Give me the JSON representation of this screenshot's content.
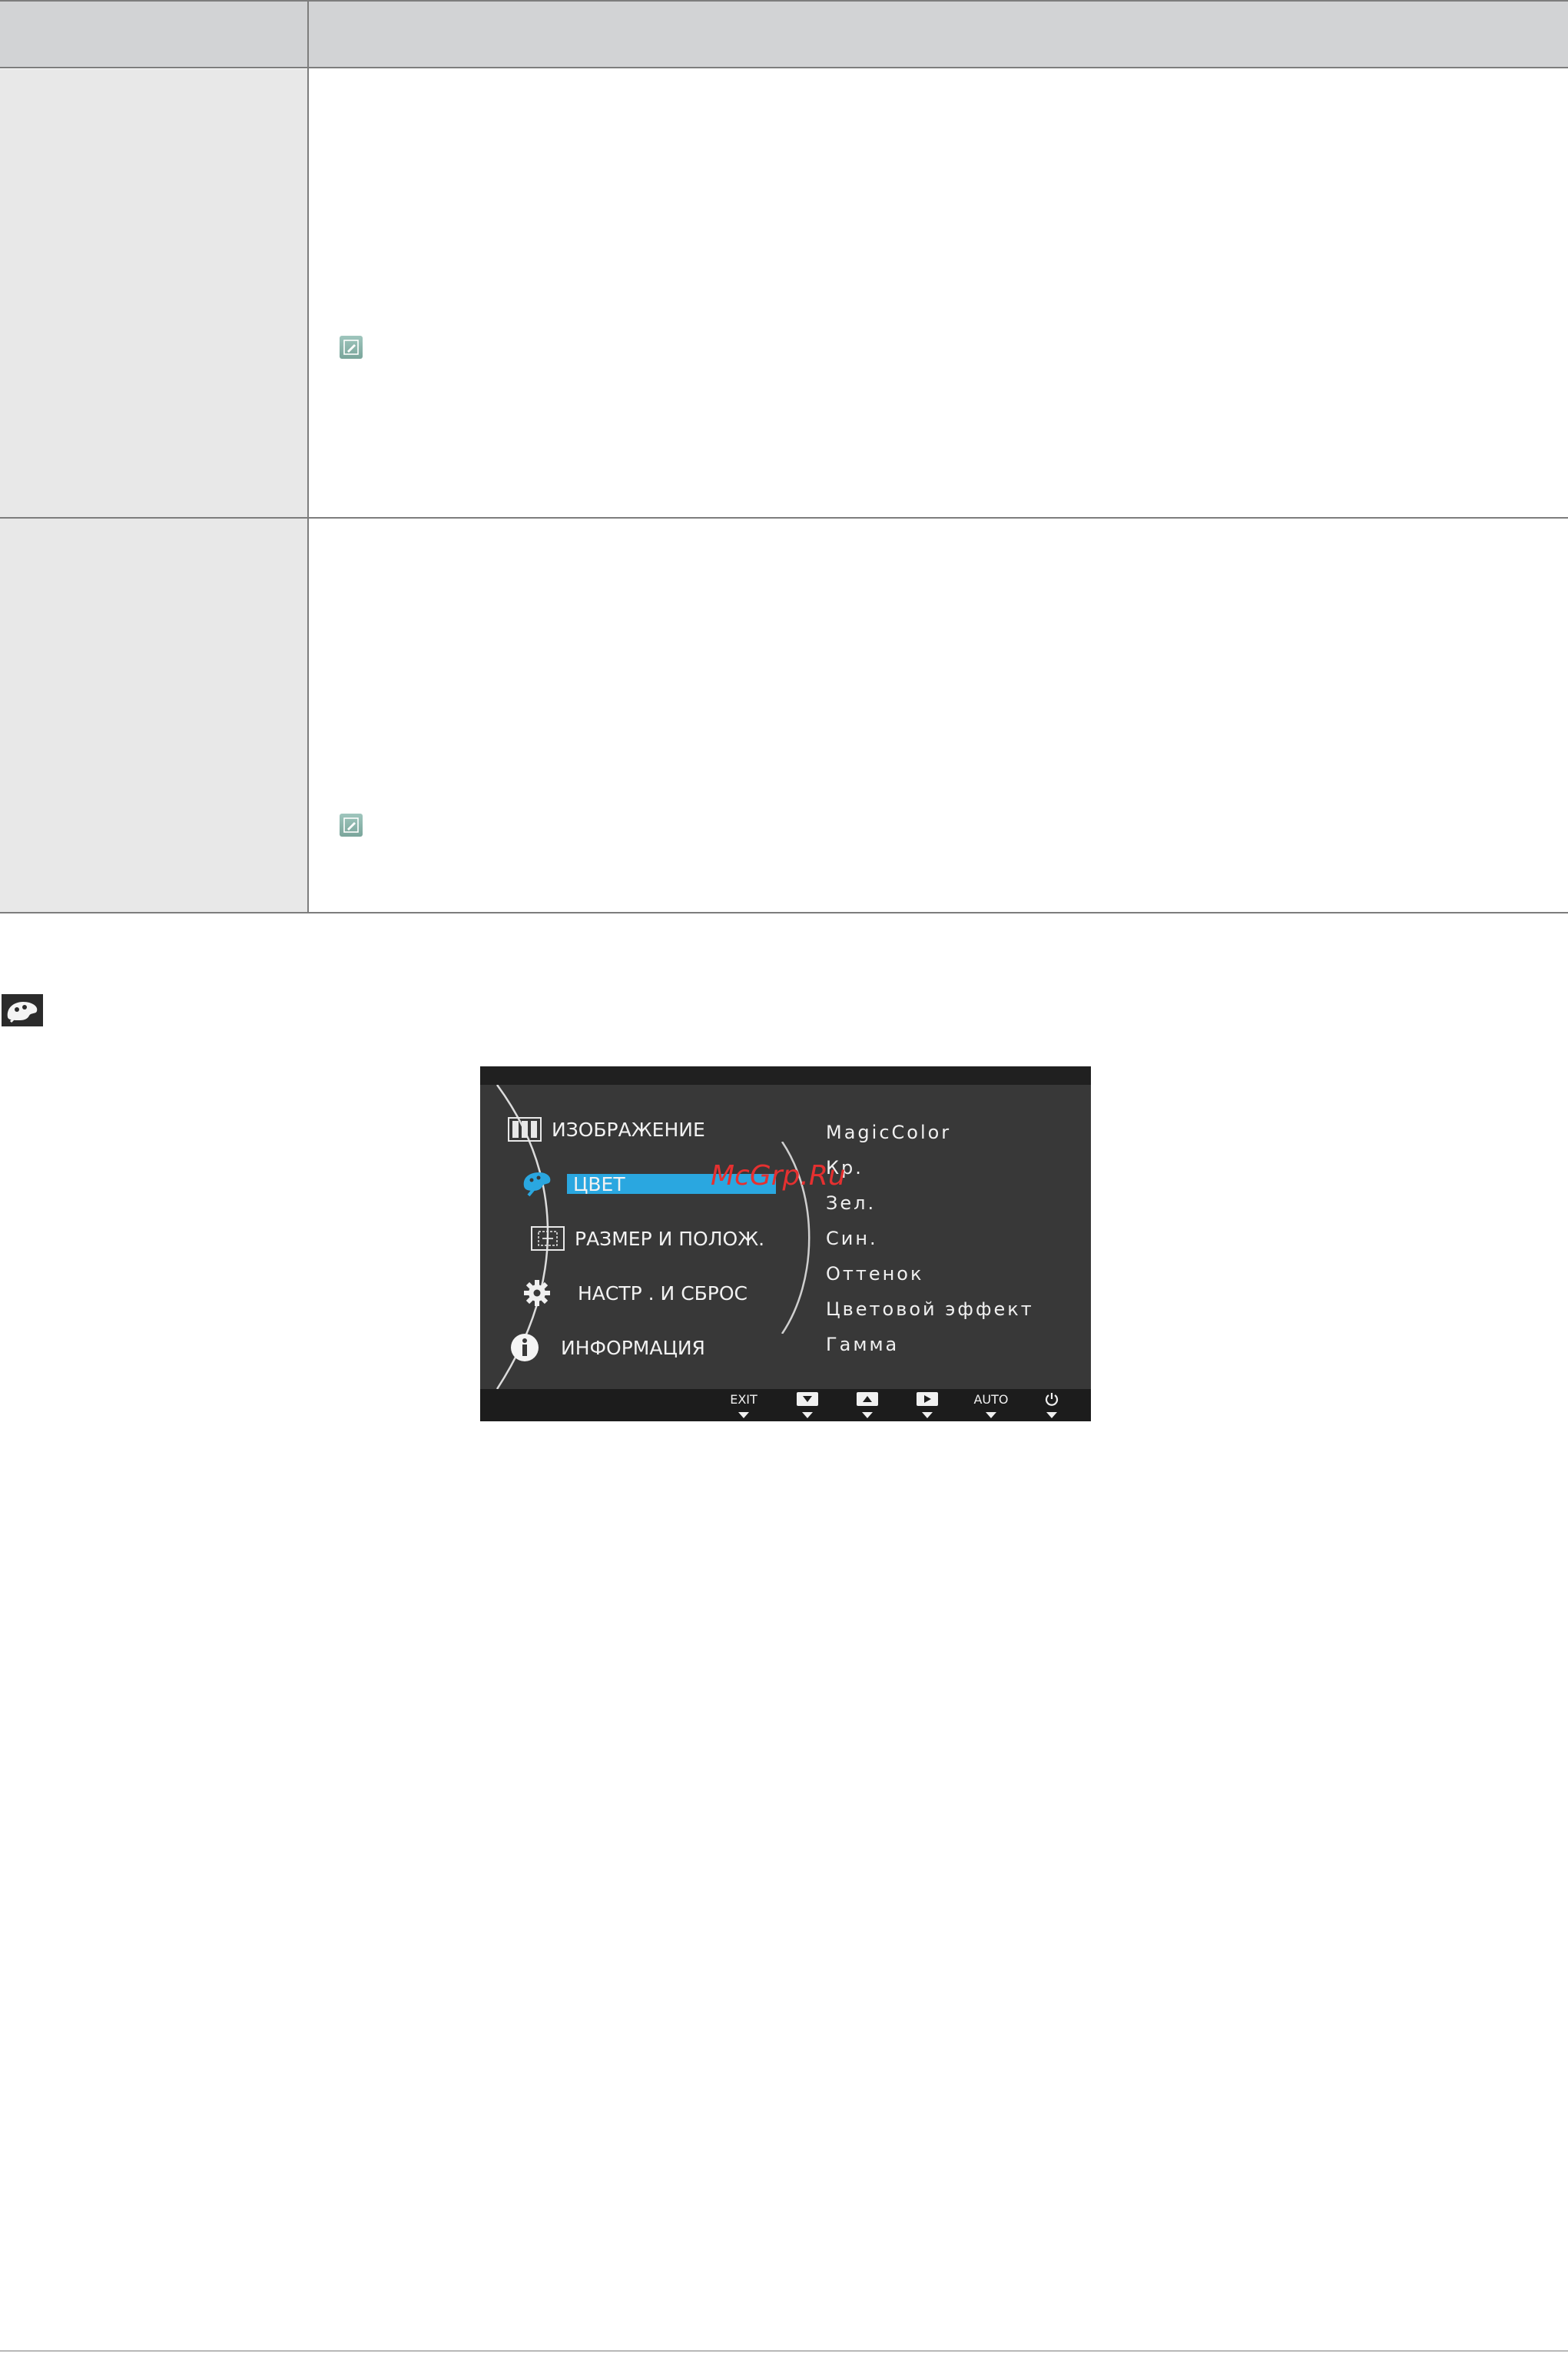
{
  "table": {
    "header": {
      "col1": "",
      "col2": ""
    },
    "rows": [
      {
        "label": "",
        "text": "",
        "note_icon": "note-pencil-icon"
      },
      {
        "label": "",
        "text": "",
        "note_icon": "note-pencil-icon"
      }
    ]
  },
  "section": {
    "icon": "color-palette-icon"
  },
  "osd": {
    "menu": [
      {
        "label": "ИЗОБРАЖЕНИЕ",
        "icon": "picture-icon",
        "selected": false
      },
      {
        "label": "ЦВЕТ",
        "icon": "color-palette-icon",
        "selected": true
      },
      {
        "label": "РАЗМЕР И ПОЛОЖ.",
        "icon": "size-position-icon",
        "selected": false
      },
      {
        "label": "НАСТР . И СБРОС",
        "icon": "gear-icon",
        "selected": false
      },
      {
        "label": "ИНФОРМАЦИЯ",
        "icon": "info-icon",
        "selected": false
      }
    ],
    "submenu": [
      "MagicColor",
      "Кр.",
      "Зел.",
      "Син.",
      "Оттенок",
      "Цветовой эффект",
      "Гамма"
    ],
    "controls": [
      {
        "label": "EXIT",
        "icon": "exit-label"
      },
      {
        "label": "",
        "icon": "down-button-icon"
      },
      {
        "label": "",
        "icon": "up-button-icon"
      },
      {
        "label": "",
        "icon": "right-button-icon"
      },
      {
        "label": "AUTO",
        "icon": "auto-label"
      },
      {
        "label": "",
        "icon": "power-icon"
      }
    ],
    "highlight_color": "#2aa7e0"
  },
  "watermark": "McGrp.Ru"
}
